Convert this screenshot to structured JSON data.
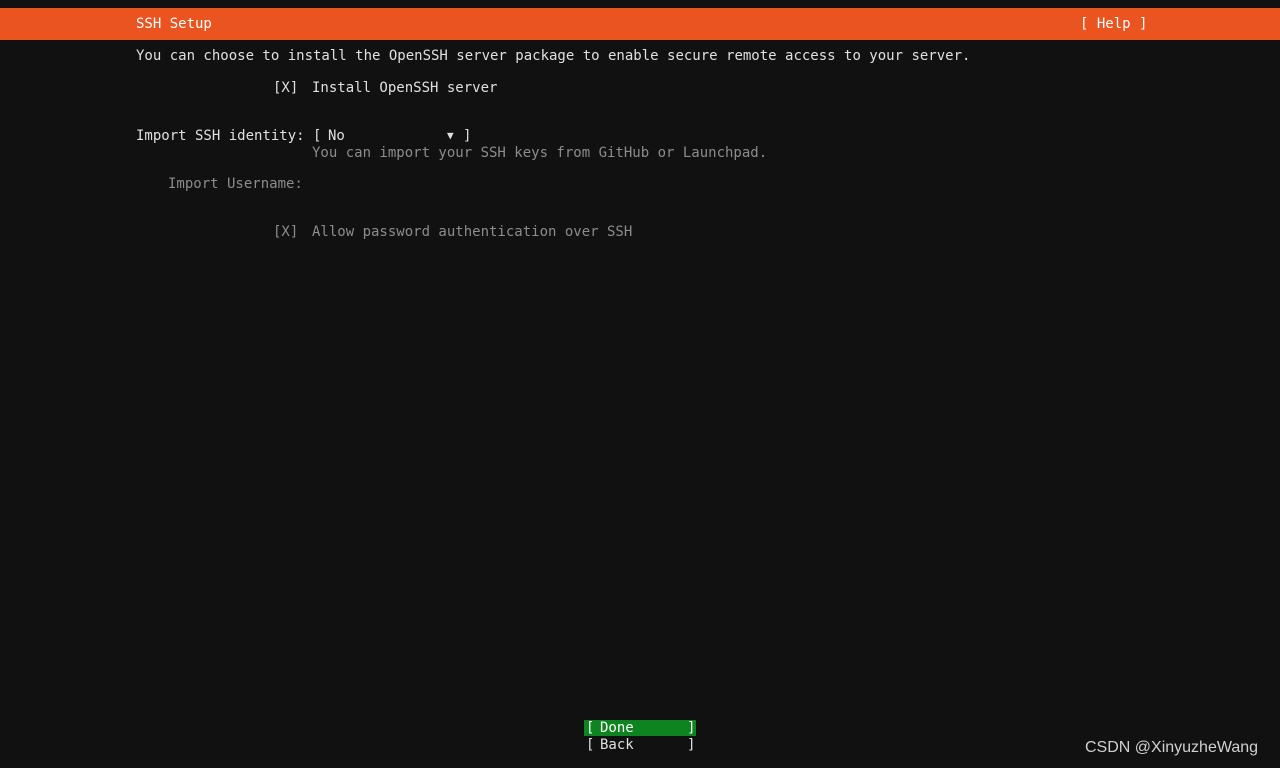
{
  "header": {
    "title": "SSH Setup",
    "help_label": "[ Help ]"
  },
  "main": {
    "intro": "You can choose to install the OpenSSH server package to enable secure remote access to your server.",
    "install_ssh": {
      "checkbox": "[X]",
      "label": "Install OpenSSH server"
    },
    "import_identity": {
      "label": "Import SSH identity:",
      "bracket_left": "[",
      "selected_value": "No",
      "arrow": "▼",
      "bracket_right": "]",
      "hint": "You can import your SSH keys from GitHub or Launchpad."
    },
    "import_username": {
      "label": "Import Username:",
      "value": ""
    },
    "allow_password": {
      "checkbox": "[X]",
      "label": "Allow password authentication over SSH"
    }
  },
  "footer": {
    "done": {
      "bracket_left": "[",
      "label": "Done",
      "bracket_right": "]"
    },
    "back": {
      "bracket_left": "[",
      "label": "Back",
      "bracket_right": "]"
    }
  },
  "watermark": "CSDN @XinyuzheWang",
  "colors": {
    "header_bg": "#e95420",
    "background": "#111111",
    "done_bg": "#0e8420",
    "dim_text": "#8c8c8c"
  }
}
